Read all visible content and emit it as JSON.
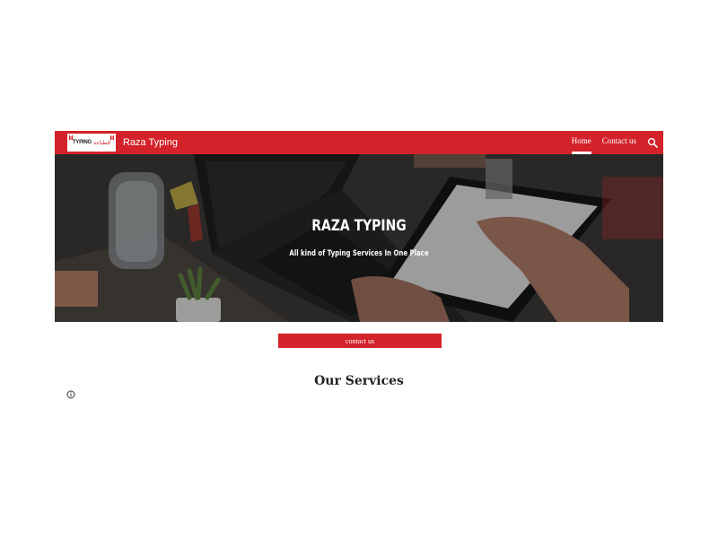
{
  "header": {
    "site_title": "Raza Typing",
    "logo": {
      "text_en": "TYPING",
      "text_ar": "للطباعة"
    },
    "nav": [
      {
        "label": "Home",
        "active": true
      },
      {
        "label": "Contact us",
        "active": false
      }
    ],
    "search_icon": "search-icon"
  },
  "hero": {
    "title": "RAZA TYPING",
    "subtitle": "All kind of Typing Services In One Place"
  },
  "cta": {
    "label": "contact us"
  },
  "services": {
    "title": "Our Services"
  },
  "footer": {
    "info_icon": "info-icon"
  },
  "colors": {
    "brand_red": "#d3222a",
    "white": "#ffffff",
    "heading": "#222222"
  }
}
